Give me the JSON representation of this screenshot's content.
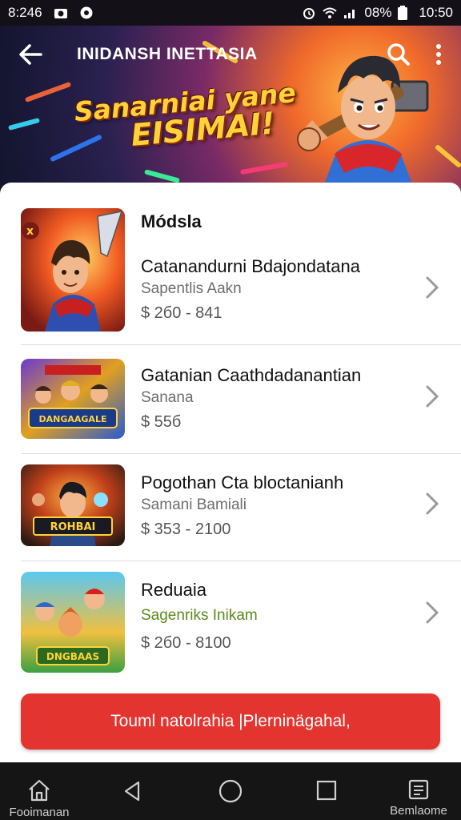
{
  "status_bar": {
    "time_left": "8:246",
    "battery": "08%",
    "time_right": "10:50"
  },
  "header": {
    "title": "INIDANSH INETTASIA"
  },
  "banner": {
    "line1": "Sanarniai yane",
    "line2": "EISIMAI!"
  },
  "list": {
    "section_title": "Módsla",
    "items": [
      {
        "title": "Catanandurni Bdajondatana",
        "subtitle": "Sapentlis Aakn",
        "price": "$ 2б0 - 841"
      },
      {
        "title": "Gatanian Caathdadanantian",
        "subtitle": "Sanana",
        "price": "$ 55б"
      },
      {
        "title": "Pogothan Cta bloctanianh",
        "subtitle": "Samani Bamiali",
        "price": "$ 353 - 2100"
      },
      {
        "title": "Reduaia",
        "subtitle": "Sagenriks Inikam",
        "price": "$ 2б0 - 8100"
      }
    ],
    "thumb_texts": [
      "DANGAAGALE",
      "ROHBAI",
      "DNGBAAS"
    ]
  },
  "cta": {
    "label": "Touml natolrahia |Plerninägahal,"
  },
  "navbar": {
    "left_label": "Fooimanan",
    "right_label": "Bemlaome"
  },
  "colors": {
    "accent_red": "#e3342f",
    "subtitle_green": "#5a8a1a",
    "banner_yellow": "#ffd23a"
  }
}
